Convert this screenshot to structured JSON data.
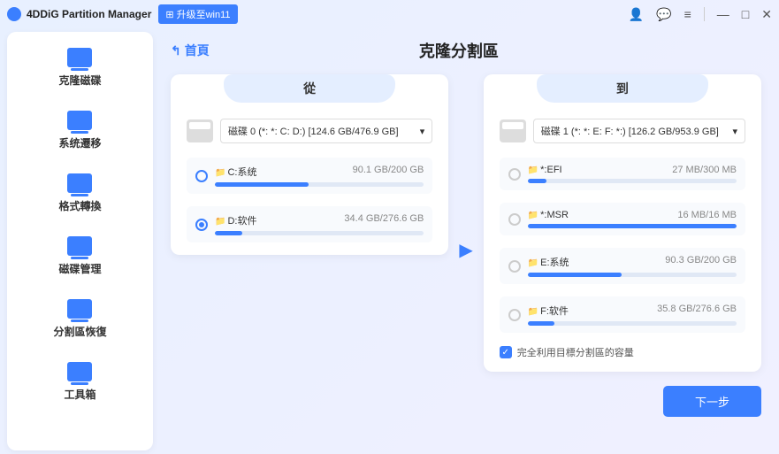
{
  "app": {
    "title": "4DDiG Partition Manager",
    "upgrade": "升级至win11"
  },
  "sidebar": {
    "items": [
      {
        "label": "克隆磁碟"
      },
      {
        "label": "系统遷移"
      },
      {
        "label": "格式轉換"
      },
      {
        "label": "磁碟管理"
      },
      {
        "label": "分割區恢復"
      },
      {
        "label": "工具箱"
      }
    ]
  },
  "header": {
    "back": "首頁",
    "title": "克隆分割區"
  },
  "source": {
    "label": "從",
    "disk": "磁碟 0 (*: *: C: D:) [124.6 GB/476.9 GB]",
    "partitions": [
      {
        "name": "C:系统",
        "size": "90.1 GB/200 GB",
        "fill": 45,
        "selected": false
      },
      {
        "name": "D:软件",
        "size": "34.4 GB/276.6 GB",
        "fill": 13,
        "selected": true
      }
    ]
  },
  "target": {
    "label": "到",
    "disk": "磁碟 1 (*: *: E: F: *:) [126.2 GB/953.9 GB]",
    "partitions": [
      {
        "name": "*:EFI",
        "size": "27 MB/300 MB",
        "fill": 9
      },
      {
        "name": "*:MSR",
        "size": "16 MB/16 MB",
        "fill": 100
      },
      {
        "name": "E:系统",
        "size": "90.3 GB/200 GB",
        "fill": 45
      },
      {
        "name": "F:软件",
        "size": "35.8 GB/276.6 GB",
        "fill": 13
      }
    ],
    "fullUse": "完全利用目標分割區的容量"
  },
  "footer": {
    "next": "下一步"
  }
}
